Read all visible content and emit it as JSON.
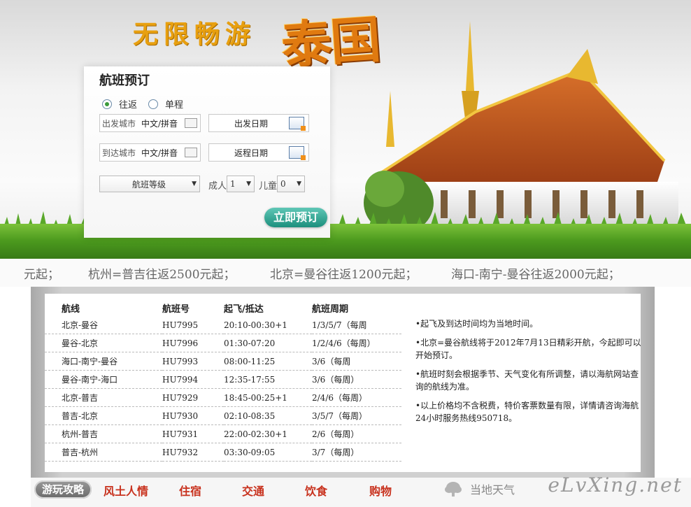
{
  "header": {
    "slogan": "无限畅游",
    "slogan_country": "泰国"
  },
  "booking": {
    "title": "航班预订",
    "trip_types": [
      {
        "label": "往返",
        "checked": true
      },
      {
        "label": "单程",
        "checked": false
      }
    ],
    "depart_city": {
      "label": "出发城市",
      "placeholder": "中文/拼音"
    },
    "arrive_city": {
      "label": "到达城市",
      "placeholder": "中文/拼音"
    },
    "depart_date": {
      "label": "出发日期"
    },
    "return_date": {
      "label": "返程日期"
    },
    "cabin_class": "航班等级",
    "adult_label": "成人",
    "adult_value": "1",
    "child_label": "儿童",
    "child_value": "0",
    "submit_label": "立即预订"
  },
  "ticker": [
    "元起；",
    "杭州=普吉往返2500元起；",
    "北京=曼谷往返1200元起；",
    "海口-南宁-曼谷往返2000元起；"
  ],
  "flights": {
    "headers": [
      "航线",
      "航班号",
      "起飞/抵达",
      "航班周期"
    ],
    "rows": [
      [
        "北京-曼谷",
        "HU7995",
        "20:10-00:30+1",
        "1/3/5/7（每周"
      ],
      [
        "曼谷-北京",
        "HU7996",
        "01:30-07:20",
        "1/2/4/6（每周）"
      ],
      [
        "海口-南宁-曼谷",
        "HU7993",
        "08:00-11:25",
        "3/6（每周"
      ],
      [
        "曼谷-南宁-海口",
        "HU7994",
        "12:35-17:55",
        "3/6（每周）"
      ],
      [
        "北京-普吉",
        "HU7929",
        "18:45-00:25+1",
        "2/4/6（每周）"
      ],
      [
        "普吉-北京",
        "HU7930",
        "02:10-08:35",
        "3/5/7（每周）"
      ],
      [
        "杭州-普吉",
        "HU7931",
        "22:00-02:30+1",
        "2/6（每周）"
      ],
      [
        "普吉-杭州",
        "HU7932",
        "03:30-09:05",
        "3/7（每周）"
      ]
    ],
    "notes": [
      "•起飞及到达时间均为当地时间。",
      "•北京=曼谷航线将于2012年7月13日精彩开航，今起即可以开始预订。",
      "•航班时刻会根据季节、天气变化有所调整，请以海航网站查询的航线为准。",
      "•以上价格均不含税费，特价客票数量有限，详情请咨询海航24小时服务热线950718。"
    ]
  },
  "nav": {
    "active": "游玩攻略",
    "items": [
      "风土人情",
      "住宿",
      "交通",
      "饮食",
      "购物"
    ],
    "weather": "当地天气"
  },
  "watermark": "eLvXing.net",
  "colors": {
    "accent": "#c8321e",
    "button": "#1c8f7d",
    "slogan": "#e8a010"
  }
}
